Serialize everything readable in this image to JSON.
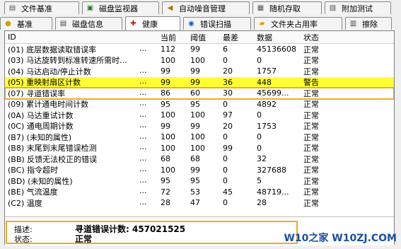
{
  "tabs_top": [
    {
      "label": "文件基准",
      "icon": "file-icon",
      "color": "#555555"
    },
    {
      "label": "磁盘监视器",
      "icon": "monitor-icon",
      "color": "#2a7a2a"
    },
    {
      "label": "自动噪音管理",
      "icon": "speaker-icon",
      "color": "#aa7700"
    },
    {
      "label": "随机存取",
      "icon": "card-icon",
      "color": "#555555"
    },
    {
      "label": "附加测试",
      "icon": "tools-icon",
      "color": "#555555"
    }
  ],
  "tabs_bottom": [
    {
      "label": "基准",
      "icon": "bulb-icon",
      "color": "#d4a000",
      "active": false
    },
    {
      "label": "磁盘信息",
      "icon": "info-icon",
      "color": "#444444",
      "active": false
    },
    {
      "label": "健康",
      "icon": "health-cross-icon",
      "color": "#d01010",
      "active": true
    },
    {
      "label": "错误扫描",
      "icon": "search-icon",
      "color": "#1060c0",
      "active": false
    },
    {
      "label": "文件夹占用率",
      "icon": "folder-icon",
      "color": "#d4a000",
      "active": false
    },
    {
      "label": "擦除",
      "icon": "trash-icon",
      "color": "#444444",
      "active": false
    }
  ],
  "columns": {
    "id": "ID",
    "current": "当前",
    "threshold": "阈值",
    "worst": "最差",
    "data": "数据",
    "status": "状态"
  },
  "rows": [
    {
      "id": "(01) 底层数据读取错误率",
      "dots": "...",
      "current": "112",
      "threshold": "99",
      "worst": "6",
      "data": "45136608",
      "status": "正常",
      "hl": ""
    },
    {
      "id": "(03) 马达旋转到标准转速所需时...",
      "dots": "",
      "current": "100",
      "threshold": "100",
      "worst": "0",
      "data": "0",
      "status": "正常",
      "hl": ""
    },
    {
      "id": "(04) 马达启动/停止计数",
      "dots": "...",
      "current": "99",
      "threshold": "99",
      "worst": "20",
      "data": "1757",
      "status": "正常",
      "hl": ""
    },
    {
      "id": "(05) 重映射扇区计数",
      "dots": "...",
      "current": "99",
      "threshold": "99",
      "worst": "36",
      "data": "448",
      "status": "警告",
      "hl": "yellow"
    },
    {
      "id": "(07) 寻道错误率",
      "dots": "...",
      "current": "86",
      "threshold": "60",
      "worst": "30",
      "data": "45699...",
      "status": "正常",
      "hl": "box"
    },
    {
      "id": "(09) 累计通电时间计数",
      "dots": "...",
      "current": "95",
      "threshold": "95",
      "worst": "0",
      "data": "4892",
      "status": "正常",
      "hl": ""
    },
    {
      "id": "(0A) 马达重试计数",
      "dots": "...",
      "current": "100",
      "threshold": "100",
      "worst": "97",
      "data": "0",
      "status": "正常",
      "hl": ""
    },
    {
      "id": "(0C) 通电周期计数",
      "dots": "...",
      "current": "99",
      "threshold": "99",
      "worst": "20",
      "data": "1753",
      "status": "正常",
      "hl": ""
    },
    {
      "id": "(B7) (未知的属性)",
      "dots": "...",
      "current": "100",
      "threshold": "100",
      "worst": "0",
      "data": "0",
      "status": "正常",
      "hl": ""
    },
    {
      "id": "(B8) 末尾到末尾错误检测",
      "dots": "...",
      "current": "100",
      "threshold": "100",
      "worst": "99",
      "data": "0",
      "status": "正常",
      "hl": ""
    },
    {
      "id": "(BB) 反馈无法校正的错误",
      "dots": "...",
      "current": "68",
      "threshold": "68",
      "worst": "0",
      "data": "32",
      "status": "正常",
      "hl": ""
    },
    {
      "id": "(BC) 指令超时",
      "dots": "...",
      "current": "100",
      "threshold": "99",
      "worst": "0",
      "data": "327688",
      "status": "正常",
      "hl": ""
    },
    {
      "id": "(BD) (未知的属性)",
      "dots": "...",
      "current": "95",
      "threshold": "95",
      "worst": "0",
      "data": "5",
      "status": "正常",
      "hl": ""
    },
    {
      "id": "(BE) 气流温度",
      "dots": "...",
      "current": "72",
      "threshold": "53",
      "worst": "45",
      "data": "48719...",
      "status": "正常",
      "hl": ""
    },
    {
      "id": "(C2) 温度",
      "dots": "...",
      "current": "28",
      "threshold": "47",
      "worst": "0",
      "data": "28",
      "status": "正常",
      "hl": ""
    }
  ],
  "detail": {
    "desc_label": "描述:",
    "desc_value": "寻道错误计数: 457021525",
    "status_label": "状态:",
    "status_value": "正常"
  },
  "watermark": "W10之家 W10ZJ.COM"
}
